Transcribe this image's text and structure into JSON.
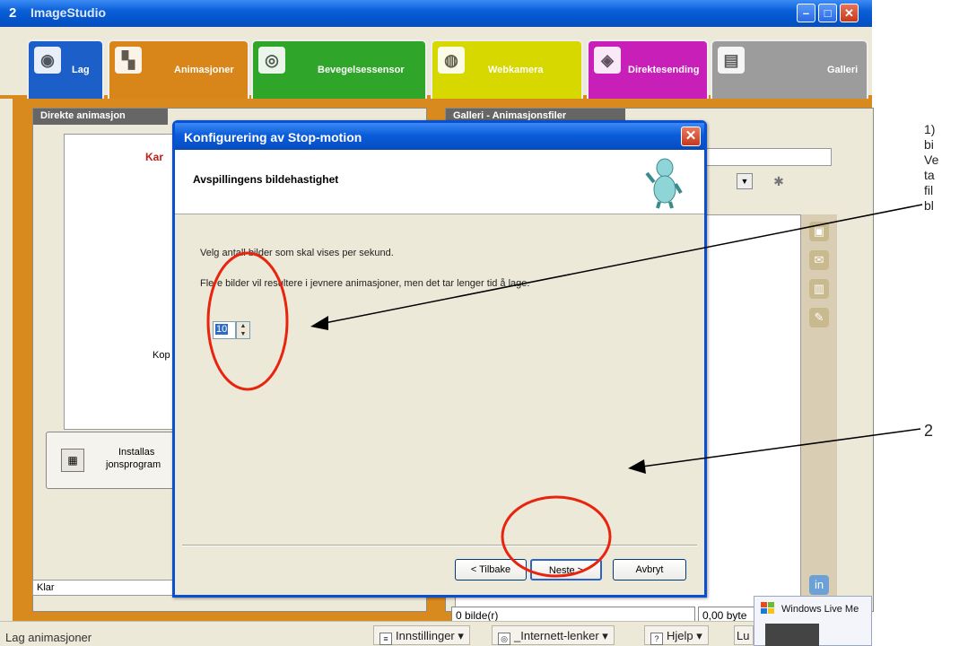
{
  "app": {
    "title": "ImageStudio",
    "title_icon": "2"
  },
  "tabs": [
    {
      "label": "Lag",
      "icon": "camera-icon",
      "color": "#1d5fc9"
    },
    {
      "label": "Animasjoner",
      "icon": "animation-icon",
      "color": "#d8851a"
    },
    {
      "label": "Bevegelsessensor",
      "icon": "motion-sensor-icon",
      "color": "#2fa52a"
    },
    {
      "label": "Webkamera",
      "icon": "webcam-icon",
      "color": "#d7d800"
    },
    {
      "label": "Direktesending",
      "icon": "broadcast-icon",
      "color": "#c71fb8"
    },
    {
      "label": "Galleri",
      "icon": "gallery-icon",
      "color": "#9c9c9c"
    }
  ],
  "left_panel": {
    "title": "Direkte animasjon",
    "partial_red": "Kar",
    "partial_text": "Kop",
    "install_label_line1": "Installas",
    "install_label_line2": "jonsprogram",
    "status": "Klar"
  },
  "right_panel": {
    "title": "Galleri - Animasjonsfiler",
    "image_count": "0 bilde(r)",
    "size": "0,00 byte"
  },
  "dialog": {
    "title": "Konfigurering av Stop-motion",
    "heading": "Avspillingens bildehastighet",
    "text1": "Velg antall bilder som skal vises per sekund.",
    "text2": "Flere bilder vil resultere i jevnere animasjoner, men det tar lenger tid å lage.",
    "fps_value": "10",
    "back_button": "< Tilbake",
    "next_button": "Neste >",
    "cancel_button": "Avbryt"
  },
  "bottombar": {
    "status": "Lag animasjoner",
    "menu": [
      "Innstillinger ▾",
      "_Internett-lenker ▾",
      "Hjelp ▾",
      "Lu"
    ]
  },
  "live_popup": {
    "text": "Windows Live Me"
  },
  "annotation": {
    "lines": [
      "1)",
      "bi",
      "Ve",
      "ta",
      "fil",
      "bl"
    ],
    "num2": "2"
  },
  "colors": {
    "accent_orange": "#d88a1e",
    "xp_blue": "#0a5fd8",
    "annotation_red": "#e8240f"
  }
}
